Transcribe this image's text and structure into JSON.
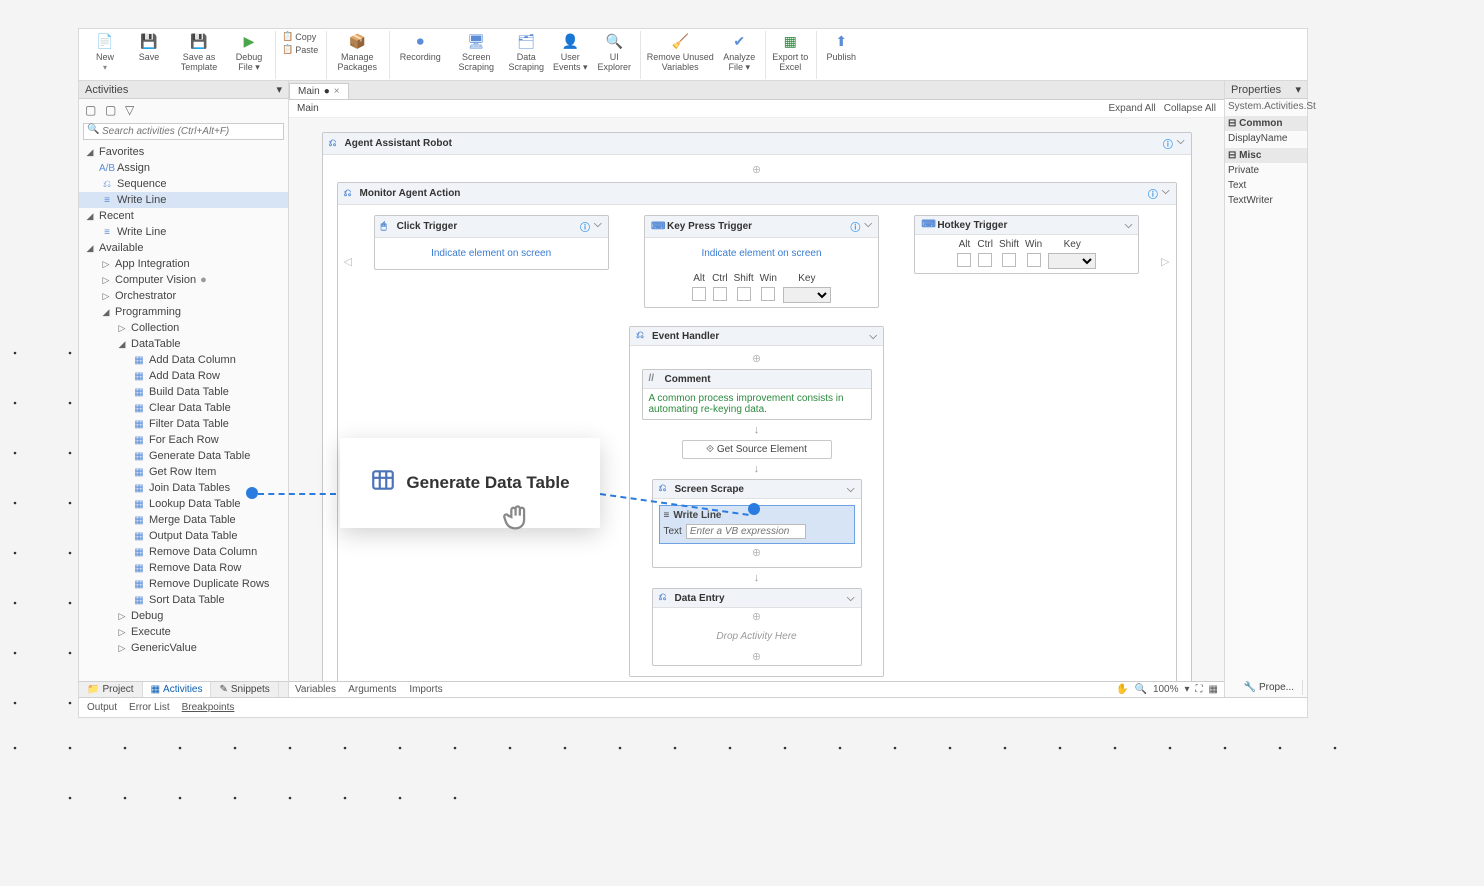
{
  "ribbon": {
    "new": "New",
    "save": "Save",
    "save_tpl": "Save as\nTemplate",
    "debug": "Debug\nFile ▾",
    "copy": "Copy",
    "paste": "Paste",
    "manage_pkg": "Manage\nPackages",
    "recording": "Recording",
    "screen_scr": "Screen\nScraping",
    "data_scr": "Data\nScraping",
    "user_ev": "User\nEvents ▾",
    "ui_ex": "UI\nExplorer",
    "rem_unused": "Remove Unused\nVariables",
    "analyze": "Analyze\nFile ▾",
    "export_excel": "Export\nto Excel",
    "publish": "Publish"
  },
  "left": {
    "title": "Activities",
    "search_ph": "Search activities (Ctrl+Alt+F)",
    "favorites": "Favorites",
    "fav_items": {
      "assign": "Assign",
      "sequence": "Sequence",
      "write_line": "Write Line"
    },
    "recent": "Recent",
    "recent_wl": "Write Line",
    "available": "Available",
    "app_int": "App Integration",
    "comp_vis": "Computer Vision",
    "orchestrator": "Orchestrator",
    "programming": "Programming",
    "collection": "Collection",
    "datatable": "DataTable",
    "dt": {
      "add_col": "Add Data Column",
      "add_row": "Add Data Row",
      "build": "Build Data Table",
      "clear": "Clear Data Table",
      "filter": "Filter Data Table",
      "foreach": "For Each Row",
      "generate": "Generate Data Table",
      "getrow": "Get Row Item",
      "join": "Join Data Tables",
      "lookup": "Lookup Data Table",
      "merge": "Merge Data Table",
      "output": "Output Data Table",
      "rem_col": "Remove Data Column",
      "rem_row": "Remove Data Row",
      "rem_dup": "Remove Duplicate Rows",
      "sort": "Sort Data Table"
    },
    "debug": "Debug",
    "execute": "Execute",
    "genval": "GenericValue",
    "tabs": {
      "project": "Project",
      "activities": "Activities",
      "snippets": "Snippets"
    }
  },
  "center": {
    "main_tab": "Main",
    "breadcrumb": "Main",
    "expand": "Expand All",
    "collapse": "Collapse All",
    "agent": "Agent Assistant Robot",
    "monitor": "Monitor Agent Action",
    "click_trig": "Click Trigger",
    "indicate": "Indicate element on screen",
    "key_trig": "Key Press Trigger",
    "hotkey": "Hotkey Trigger",
    "alt": "Alt",
    "ctrl": "Ctrl",
    "shift": "Shift",
    "win": "Win",
    "key": "Key",
    "ev_handler": "Event Handler",
    "comment": "Comment",
    "comment_text": "A common process improvement consists in automating re-keying data.",
    "get_src": "Get Source Element",
    "scr_scrape": "Screen Scrape",
    "write_line": "Write Line",
    "text_lbl": "Text",
    "vb_ph": "Enter a VB expression",
    "data_entry": "Data Entry",
    "drop_here": "Drop Activity Here",
    "vars": "Variables",
    "args": "Arguments",
    "imp": "Imports",
    "zoom": "100%"
  },
  "props": {
    "title": "Properties",
    "sys": "System.Activities.St",
    "common": "Common",
    "display": "DisplayName",
    "misc": "Misc",
    "private": "Private",
    "text": "Text",
    "tw": "TextWriter",
    "btn": "Prope..."
  },
  "status": {
    "output": "Output",
    "err": "Error List",
    "brk": "Breakpoints"
  },
  "float": {
    "label": "Generate Data Table"
  }
}
